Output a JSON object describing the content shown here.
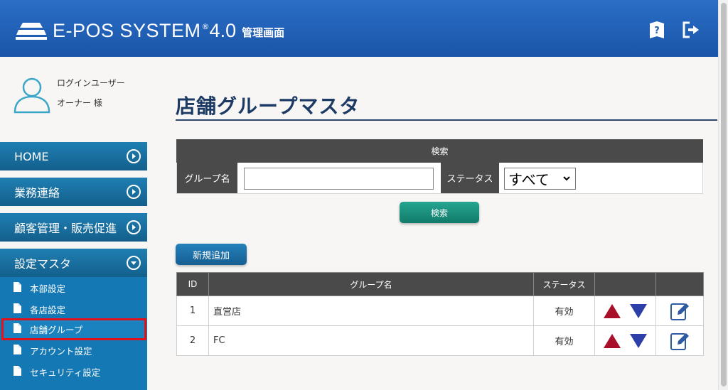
{
  "header": {
    "brand": "E-POS SYSTEM",
    "registered": "®",
    "version": "4.0",
    "subtitle": "管理画面"
  },
  "user": {
    "line1": "ログインユーザー",
    "line2": "オーナー 様"
  },
  "nav": {
    "items": [
      {
        "label": "HOME",
        "icon": "circle-arrow-right-icon"
      },
      {
        "label": "業務連絡",
        "icon": "circle-arrow-right-icon"
      },
      {
        "label": "顧客管理・販売促進",
        "icon": "circle-arrow-right-icon"
      },
      {
        "label": "設定マスタ",
        "icon": "circle-arrow-down-icon"
      }
    ],
    "submenu": [
      {
        "label": "本部設定"
      },
      {
        "label": "各店設定"
      },
      {
        "label": "店舗グループ",
        "active": true
      },
      {
        "label": "アカウント設定"
      },
      {
        "label": "セキュリティ設定"
      }
    ]
  },
  "page": {
    "title": "店舗グループマスタ"
  },
  "search": {
    "header": "検索",
    "group_label": "グループ名",
    "group_value": "",
    "status_label": "ステータス",
    "status_selected": "すべて",
    "button": "検索"
  },
  "actions": {
    "new_button": "新規追加"
  },
  "table": {
    "headers": [
      "ID",
      "グループ名",
      "ステータス",
      "",
      ""
    ],
    "rows": [
      {
        "id": "1",
        "name": "直営店",
        "status": "有効"
      },
      {
        "id": "2",
        "name": "FC",
        "status": "有効"
      }
    ]
  },
  "colors": {
    "header_bg": "#1f5fb5",
    "nav_bg": "#1a70a5",
    "accent_red": "#a8102a",
    "accent_blue": "#2d3fa8",
    "search_button": "#1a8c79",
    "active_outline": "#e0121b"
  }
}
